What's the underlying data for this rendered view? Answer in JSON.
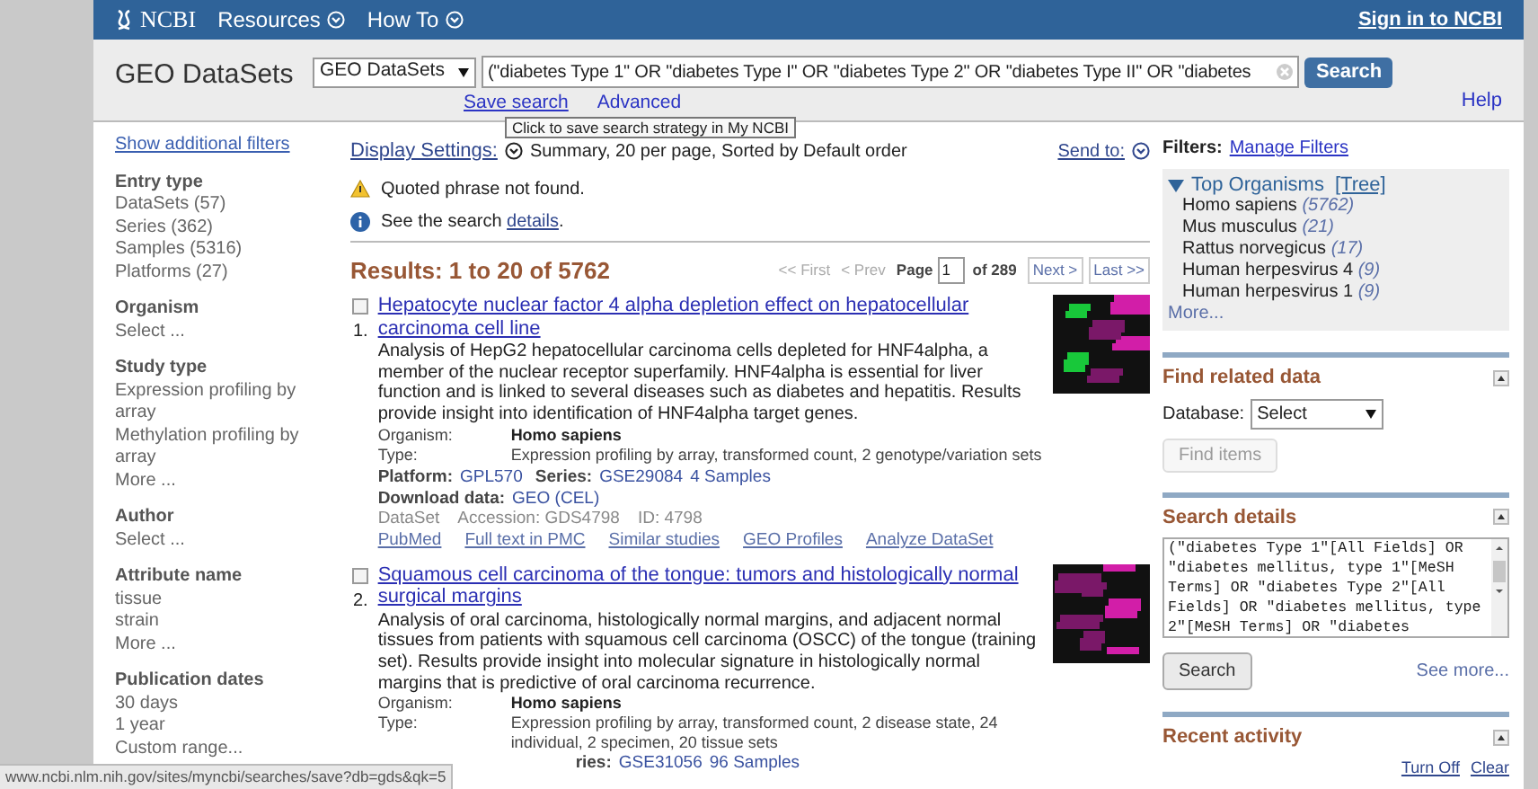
{
  "topbar": {
    "logo": "NCBI",
    "menus": [
      "Resources",
      "How To"
    ],
    "sign_in": "Sign in to NCBI"
  },
  "header": {
    "title": "GEO DataSets",
    "database": "GEO DataSets",
    "query": "(\"diabetes Type 1\" OR \"diabetes Type I\" OR \"diabetes Type 2\" OR \"diabetes Type II\" OR \"diabetes",
    "search_button": "Search",
    "links": [
      "Save search",
      "Advanced"
    ],
    "help": "Help"
  },
  "tooltip": "Click to save search strategy in My NCBI",
  "sidebar": {
    "show_filters": "Show additional filters",
    "groups": [
      {
        "title": "Entry type",
        "items": [
          "DataSets (57)",
          "Series (362)",
          "Samples (5316)",
          "Platforms (27)"
        ]
      },
      {
        "title": "Organism",
        "items": [
          "Select ..."
        ]
      },
      {
        "title": "Study type",
        "items": [
          "Expression profiling by array",
          "Methylation profiling by array",
          "More ..."
        ]
      },
      {
        "title": "Author",
        "items": [
          "Select ..."
        ]
      },
      {
        "title": "Attribute name",
        "items": [
          "tissue",
          "strain",
          "More ..."
        ]
      },
      {
        "title": "Publication dates",
        "items": [
          "30 days",
          "1 year",
          "Custom range..."
        ]
      }
    ]
  },
  "display": {
    "label": "Display Settings:",
    "summary": "Summary, 20 per page, Sorted by Default order",
    "send_to": "Send to:"
  },
  "messages": [
    {
      "kind": "warning",
      "text": "Quoted phrase not found."
    },
    {
      "kind": "info",
      "text": "See the search ",
      "link": "details",
      "after": "."
    }
  ],
  "results_heading": "Results: 1 to 20 of 5762",
  "pager": {
    "first": "<< First",
    "prev": "< Prev",
    "page_label": "Page",
    "page": "1",
    "of": "of 289",
    "next": "Next >",
    "last": "Last >>"
  },
  "results": [
    {
      "number": "1.",
      "checked": false,
      "title": "Hepatocyte nuclear factor 4 alpha depletion effect on hepatocellular carcinoma cell line",
      "description": "Analysis of HepG2 hepatocellular carcinoma cells depleted for HNF4alpha, a member of the nuclear receptor superfamily. HNF4alpha is essential for liver function and is linked to several diseases such as diabetes and hepatitis. Results provide insight into identification of HNF4alpha target genes.",
      "fields": [
        {
          "label": "Organism:",
          "value": "Homo sapiens",
          "kind": "bold"
        },
        {
          "label": "Type:",
          "value": "Expression profiling by array, transformed count, 2 genotype/variation sets",
          "kind": "plain"
        }
      ],
      "platform": {
        "label": "Platform:",
        "platform": "GPL570",
        "series_label": "Series:",
        "series": "GSE29084",
        "samples": "4 Samples"
      },
      "download": {
        "label": "Download data:",
        "value": "GEO (CEL)"
      },
      "meta": [
        "DataSet",
        "Accession: GDS4798",
        "ID: 4798"
      ],
      "links": [
        "PubMed",
        "Full text in PMC",
        "Similar studies",
        "GEO Profiles",
        "Analyze DataSet"
      ],
      "thumb": {
        "kind": "picture"
      }
    },
    {
      "number": "2.",
      "checked": false,
      "title": "Squamous cell carcinoma of the tongue: tumors and histologically normal surgical margins",
      "description": "Analysis of oral carcinoma, histologically normal margins, and adjacent normal tissues from patients with squamous cell carcinoma (OSCC) of the tongue (training set). Results provide insight into molecular signature in histologically normal margins that is predictive of oral carcinoma recurrence.",
      "fields": [
        {
          "label": "Organism:",
          "value": "Homo sapiens",
          "kind": "bold"
        },
        {
          "label": "Type:",
          "value": "Expression profiling by array, transformed count, 2 disease state, 24 individual, 2 specimen, 20 tissue sets",
          "kind": "plain"
        }
      ],
      "partial_line": {
        "label": "ries:",
        "series": "GSE31056",
        "samples": "96 Samples"
      },
      "thumb": {
        "kind": "picture"
      }
    }
  ],
  "right": {
    "filters_label": "Filters:",
    "manage": "Manage Filters",
    "organisms": {
      "title": "Top Organisms",
      "tree": "[Tree]",
      "expanded": true,
      "items": [
        {
          "name": "Homo sapiens",
          "count": "(5762)"
        },
        {
          "name": "Mus musculus",
          "count": "(21)"
        },
        {
          "name": "Rattus norvegicus",
          "count": "(17)"
        },
        {
          "name": "Human herpesvirus 4",
          "count": "(9)"
        },
        {
          "name": "Human herpesvirus 1",
          "count": "(9)"
        }
      ],
      "more": "More..."
    },
    "find_related": {
      "title": "Find related data",
      "db_label": "Database:",
      "db_value": "Select",
      "button": "Find items",
      "disabled": true
    },
    "search_details": {
      "title": "Search details",
      "text": "(\"diabetes Type 1\"[All Fields] OR \"diabetes mellitus, type 1\"[MeSH Terms] OR \"diabetes Type 2\"[All Fields] OR \"diabetes mellitus, type 2\"[MeSH Terms] OR \"diabetes",
      "button": "Search",
      "see_more": "See more..."
    },
    "recent": {
      "title": "Recent activity",
      "links": [
        "Turn Off",
        "Clear"
      ]
    }
  },
  "status_bar": "www.ncbi.nlm.nih.gov/sites/myncbi/searches/save?db=gds&qk=5"
}
